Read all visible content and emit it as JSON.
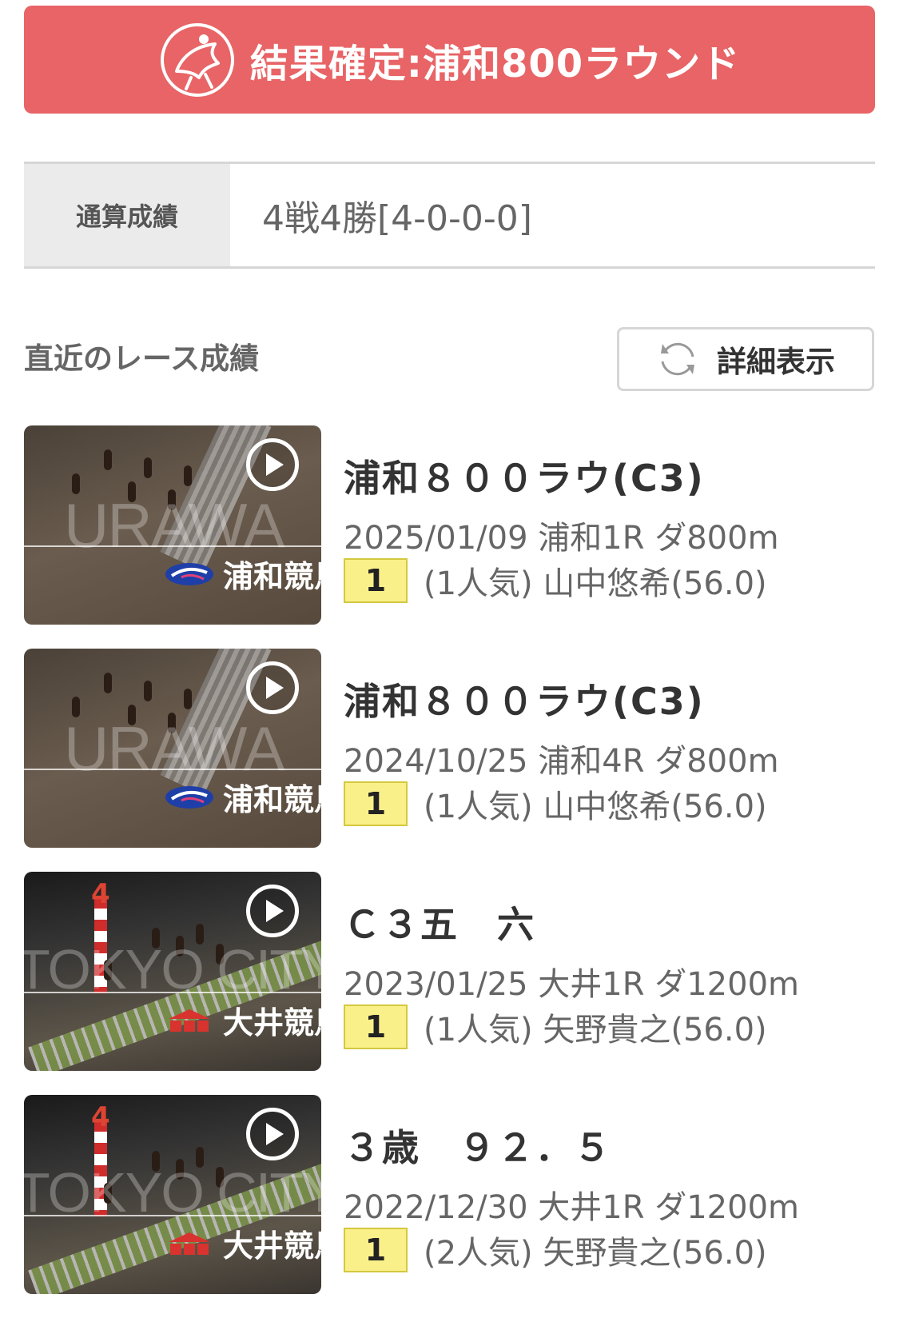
{
  "banner": {
    "title": "結果確定:浦和800ラウンド"
  },
  "record": {
    "label": "通算成績",
    "value": "4戦4勝[4-0-0-0]"
  },
  "recent": {
    "title": "直近のレース成績",
    "detail_button": "詳細表示"
  },
  "races": [
    {
      "name": "浦和８００ラウ(C3)",
      "meta": "2025/01/09 浦和1R ダ800m",
      "rank": "1",
      "result": "(1人気) 山中悠希(56.0)",
      "thumb_watermark": "URAWA",
      "thumb_track": "浦和競馬"
    },
    {
      "name": "浦和８００ラウ(C3)",
      "meta": "2024/10/25 浦和4R ダ800m",
      "rank": "1",
      "result": "(1人気) 山中悠希(56.0)",
      "thumb_watermark": "URAWA",
      "thumb_track": "浦和競馬"
    },
    {
      "name": "Ｃ３五　六",
      "meta": "2023/01/25 大井1R ダ1200m",
      "rank": "1",
      "result": "(1人気) 矢野貴之(56.0)",
      "thumb_watermark": "TOKYO CITY KEIBA",
      "thumb_track": "大井競馬",
      "thumb_post": "4"
    },
    {
      "name": "３歳　９２．５",
      "meta": "2022/12/30 大井1R ダ1200m",
      "rank": "1",
      "result": "(2人気) 矢野貴之(56.0)",
      "thumb_watermark": "TOKYO CITY KEIBA",
      "thumb_track": "大井競馬",
      "thumb_post": "4"
    }
  ],
  "colors": {
    "banner": "#e86466",
    "rank_badge": "#faf08a"
  },
  "icons": {
    "banner": "jockey-horse-icon",
    "detail": "refresh-icon",
    "video": "play-icon"
  }
}
